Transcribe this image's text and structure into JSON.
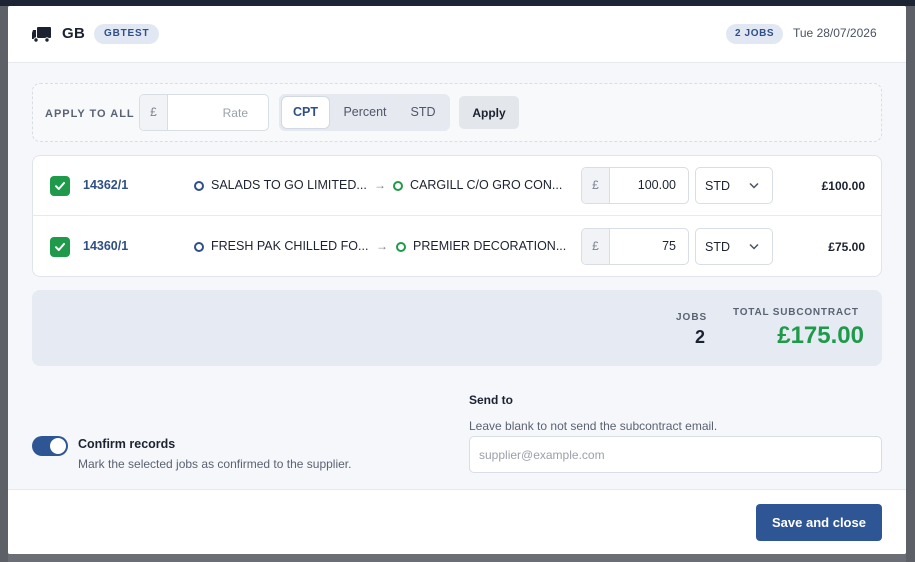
{
  "header": {
    "code": "GB",
    "badge": "GBTEST",
    "jobs_badge": "2 JOBS",
    "date": "Tue 28/07/2026"
  },
  "apply_all": {
    "label": "APPLY TO ALL",
    "currency": "£",
    "rate_placeholder": "Rate",
    "modes": [
      "CPT",
      "Percent",
      "STD"
    ],
    "active_mode": "CPT",
    "apply_label": "Apply"
  },
  "jobs": [
    {
      "checked": true,
      "id": "14362/1",
      "origin": "SALADS TO GO LIMITED...",
      "destination": "CARGILL C/O GRO CON...",
      "currency": "£",
      "amount": "100.00",
      "unit": "STD",
      "total": "£100.00"
    },
    {
      "checked": true,
      "id": "14360/1",
      "origin": "FRESH PAK CHILLED FO...",
      "destination": "PREMIER DECORATION...",
      "currency": "£",
      "amount": "75",
      "unit": "STD",
      "total": "£75.00"
    }
  ],
  "summary": {
    "jobs_label": "JOBS",
    "jobs_count": "2",
    "total_label": "TOTAL SUBCONTRACT",
    "total_value": "£175.00"
  },
  "confirm": {
    "enabled": true,
    "title": "Confirm records",
    "description": "Mark the selected jobs as confirmed to the supplier."
  },
  "send_to": {
    "label": "Send to",
    "help": "Leave blank to not send the subcontract email.",
    "placeholder": "supplier@example.com",
    "value": ""
  },
  "footer": {
    "save_label": "Save and close"
  },
  "colors": {
    "primary": "#2f5694",
    "link": "#2f4f86",
    "success": "#1f9a4a"
  }
}
